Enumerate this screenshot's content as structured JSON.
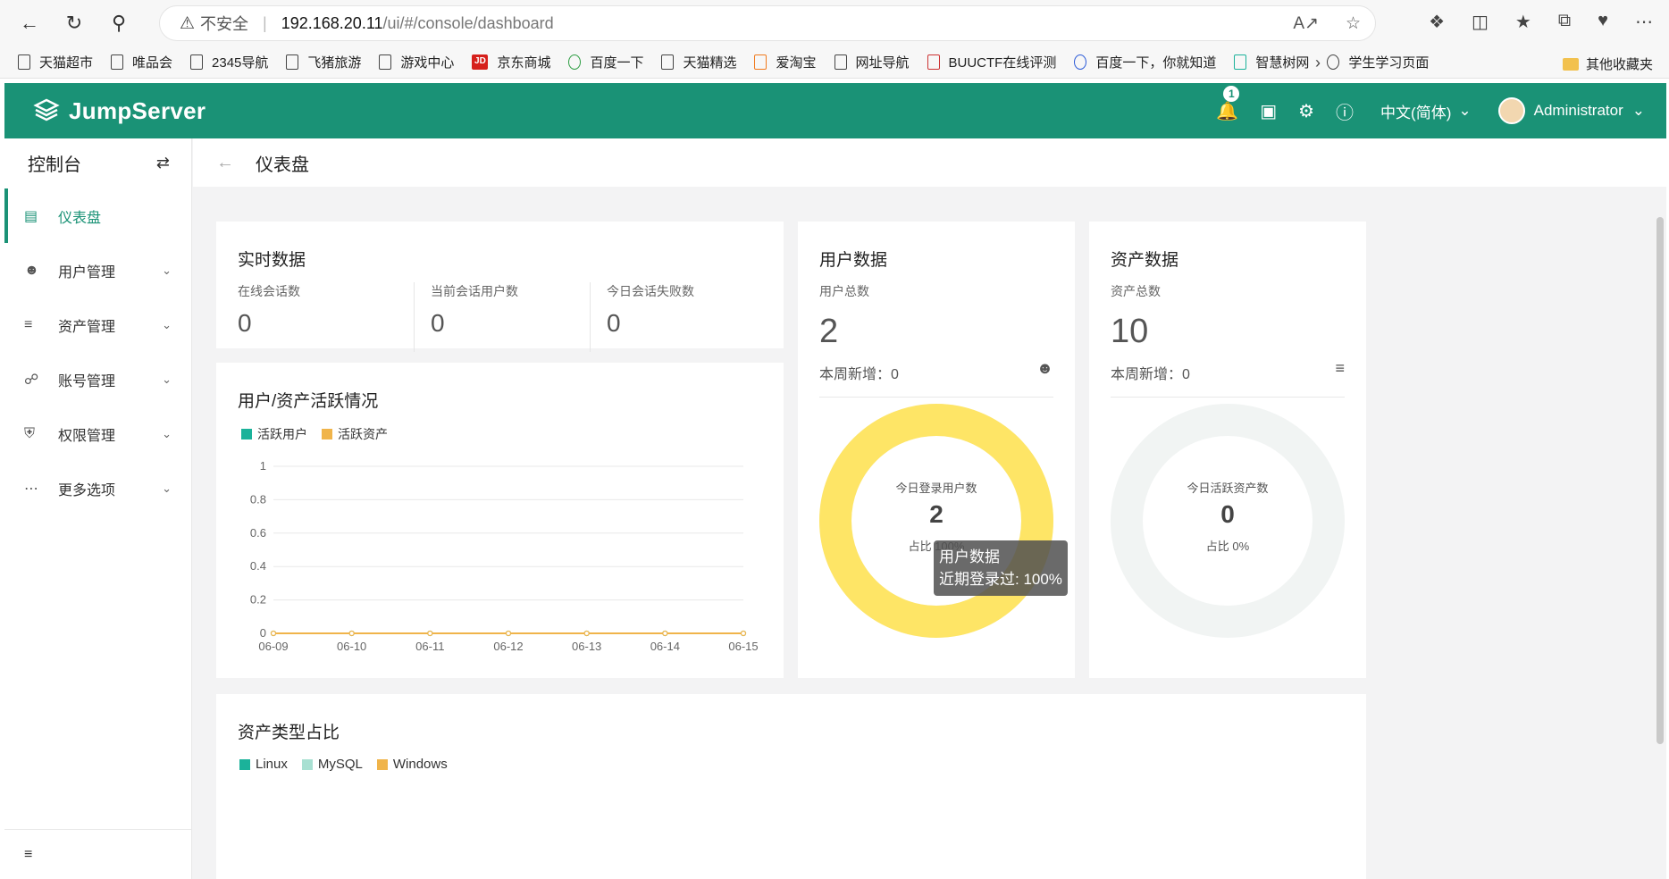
{
  "browser": {
    "address": {
      "insecure": "不安全",
      "host": "192.168.20.11",
      "path": "/ui/#/console/dashboard"
    },
    "bookmarks": [
      {
        "label": "天猫超市",
        "icon": "page-icon"
      },
      {
        "label": "唯品会",
        "icon": "page-icon"
      },
      {
        "label": "2345导航",
        "icon": "page-icon"
      },
      {
        "label": "飞猪旅游",
        "icon": "page-icon"
      },
      {
        "label": "游戏中心",
        "icon": "page-icon"
      },
      {
        "label": "京东商城",
        "icon": "jd-icon"
      },
      {
        "label": "百度一下",
        "icon": "baidu-icon"
      },
      {
        "label": "天猫精选",
        "icon": "page-icon"
      },
      {
        "label": "爱淘宝",
        "icon": "taobao-icon"
      },
      {
        "label": "网址导航",
        "icon": "page-icon"
      },
      {
        "label": "BUUCTF在线评测",
        "icon": "buu-icon"
      },
      {
        "label": "百度一下，你就知道",
        "icon": "baidu-paw-icon"
      },
      {
        "label": "智慧树网",
        "icon": "zhihuishu-icon"
      },
      {
        "label": "学生学习页面",
        "icon": "globe-icon"
      }
    ],
    "other_bookmarks": "其他收藏夹"
  },
  "app": {
    "brand": "JumpServer",
    "notification_count": "1",
    "language": "中文(简体)",
    "user": "Administrator",
    "accent": "#1a9276"
  },
  "sidebar": {
    "title": "控制台",
    "items": [
      {
        "label": "仪表盘",
        "icon": "dashboard-icon",
        "active": true
      },
      {
        "label": "用户管理",
        "icon": "users-icon"
      },
      {
        "label": "资产管理",
        "icon": "layers-icon"
      },
      {
        "label": "账号管理",
        "icon": "account-icon"
      },
      {
        "label": "权限管理",
        "icon": "shield-icon"
      },
      {
        "label": "更多选项",
        "icon": "more-icon"
      }
    ]
  },
  "breadcrumb": {
    "title": "仪表盘"
  },
  "realtime": {
    "title": "实时数据",
    "stats": [
      {
        "label": "在线会话数",
        "value": "0"
      },
      {
        "label": "当前会话用户数",
        "value": "0"
      },
      {
        "label": "今日会话失败数",
        "value": "0"
      }
    ]
  },
  "users_card": {
    "title": "用户数据",
    "total_label": "用户总数",
    "total": "2",
    "week_label": "本周新增：",
    "week_value": "0",
    "donut_title": "今日登录用户数",
    "donut_value": "2",
    "donut_pct": "占比 100%",
    "tooltip_title": "用户数据",
    "tooltip_text": "近期登录过: 100%",
    "ring_fraction": 1.0,
    "ring_color": "#fee566"
  },
  "assets_card": {
    "title": "资产数据",
    "total_label": "资产总数",
    "total": "10",
    "week_label": "本周新增：",
    "week_value": "0",
    "donut_title": "今日活跃资产数",
    "donut_value": "0",
    "donut_pct": "占比 0%",
    "ring_fraction": 0.0,
    "ring_color": "#f1f4f3"
  },
  "activity": {
    "title": "用户/资产活跃情况",
    "legend": [
      {
        "label": "活跃用户",
        "color": "#1bb29a"
      },
      {
        "label": "活跃资产",
        "color": "#f0b44a"
      }
    ]
  },
  "asset_types": {
    "title": "资产类型占比",
    "legend": [
      {
        "label": "Linux",
        "color": "#1bb29a"
      },
      {
        "label": "MySQL",
        "color": "#a8e0d2"
      },
      {
        "label": "Windows",
        "color": "#f0b44a"
      }
    ]
  },
  "chart_data": {
    "type": "line",
    "x": [
      "06-09",
      "06-10",
      "06-11",
      "06-12",
      "06-13",
      "06-14",
      "06-15"
    ],
    "series": [
      {
        "name": "活跃用户",
        "values": [
          0,
          0,
          0,
          0,
          0,
          0,
          0
        ]
      },
      {
        "name": "活跃资产",
        "values": [
          0,
          0,
          0,
          0,
          0,
          0,
          0
        ]
      }
    ],
    "yticks": [
      "0",
      "0.2",
      "0.4",
      "0.6",
      "0.8",
      "1"
    ],
    "ylim": [
      0,
      1
    ],
    "grid": true,
    "legend": "top-left"
  }
}
